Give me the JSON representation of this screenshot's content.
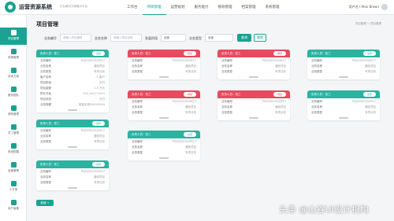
{
  "app": {
    "name": "运营资源系统",
    "subtitle": "行业解决方案展示平台"
  },
  "nav": [
    "工作台",
    "项目管理",
    "运营规划",
    "服务能力",
    "绩效管理",
    "档案管理",
    "系统管理"
  ],
  "user": {
    "label": "用户名 / Alex Brown"
  },
  "sidebar": [
    "项目管理",
    "资源管理",
    "技术方案",
    "服务团队",
    "绩效管理",
    "员工管理",
    "系统配置",
    "运营管理",
    "人才库",
    "用户画像"
  ],
  "page": {
    "title": "项目管理",
    "breadcrumb": "项目管理 > 项目管理"
  },
  "filters": {
    "code_label": "业务编号",
    "code_placeholder": "请输入项目编号",
    "name_label": "业务名称",
    "name_placeholder": "请输入项目名称",
    "stage_label": "发展阶段",
    "stage_value": "全部",
    "type_label": "业务类型",
    "type_value": "全部",
    "query": "查询",
    "reset": "重置"
  },
  "cards": [
    {
      "owner": "负责人员：张三",
      "status": "运营",
      "theme": "teal",
      "rows": [
        [
          "业务编号",
          "PGJ02020010917"
        ],
        [
          "业务名称",
          "通信项目"
        ],
        [
          "业务类型",
          "专项业务"
        ],
        [
          "客户名称",
          "5-客户"
        ],
        [
          "项目阶段",
          "交付"
        ],
        [
          "项目金额",
          "1.5 万元"
        ],
        [
          "预计开始",
          "12/1-2017-2019"
        ],
        [
          "项目状态",
          "交付"
        ],
        [
          "业务规模",
          "某某区域5444-8594"
        ]
      ]
    },
    {
      "owner": "负责人员：张三",
      "status": "规划",
      "theme": "red",
      "rows": [
        [
          "业务编号",
          "PGJ02020010917"
        ],
        [
          "业务名称",
          "通信项目"
        ],
        [
          "业务类型",
          "专项业务"
        ]
      ]
    },
    {
      "owner": "负责人员：张三",
      "status": "规划",
      "theme": "red",
      "rows": [
        [
          "业务编号",
          "PGJ02020010917"
        ],
        [
          "业务名称",
          "通信项目"
        ],
        [
          "业务类型",
          "专项业务"
        ]
      ]
    },
    {
      "owner": "负责人员：张三",
      "status": "运营",
      "theme": "teal",
      "rows": [
        [
          "业务编号",
          "PGJ02020010917"
        ],
        [
          "业务名称",
          "通信项目"
        ],
        [
          "业务类型",
          "专项业务"
        ]
      ]
    },
    {
      "owner": "负责人员：张三",
      "status": "规划",
      "theme": "red",
      "rows": [
        [
          "业务编号",
          "PGJ02020010917"
        ],
        [
          "业务名称",
          "通信项目"
        ],
        [
          "业务类型",
          "专项业务"
        ]
      ]
    },
    {
      "owner": "负责人员：张三",
      "status": "规划",
      "theme": "red",
      "rows": [
        [
          "业务编号",
          "PGJ02020010917"
        ],
        [
          "业务名称",
          "通信项目"
        ],
        [
          "业务类型",
          "专项业务"
        ]
      ]
    },
    {
      "owner": "负责人员：张三",
      "status": "运营",
      "theme": "teal",
      "rows": [
        [
          "业务编号",
          "PGJ02020010917"
        ],
        [
          "业务名称",
          "通信项目"
        ],
        [
          "业务类型",
          "专项业务"
        ]
      ]
    },
    {
      "owner": "负责人员：张三",
      "status": "运营",
      "theme": "teal",
      "rows": [
        [
          "业务编号",
          "PGJ02020010917"
        ],
        [
          "业务名称",
          "通信项目"
        ],
        [
          "业务类型",
          "专项业务"
        ]
      ]
    },
    {
      "owner": "负责人员：张三",
      "status": "运营",
      "theme": "teal",
      "rows": [
        [
          "业务编号",
          "PGJ02020010917"
        ],
        [
          "业务名称",
          "通信项目"
        ],
        [
          "业务类型",
          "专项业务"
        ]
      ]
    },
    {
      "owner": "负责人员：张三",
      "status": "运营",
      "theme": "teal",
      "rows": [
        [
          "业务编号",
          "PGJ02020010917"
        ],
        [
          "业务名称",
          "通信项目"
        ],
        [
          "业务类型",
          "专项业务"
        ]
      ]
    }
  ],
  "add_button": "新增 +",
  "watermark": "头条 @山谷UI设计机构",
  "colors": {
    "accent": "#1aa392",
    "planning": "#e84a5f"
  }
}
